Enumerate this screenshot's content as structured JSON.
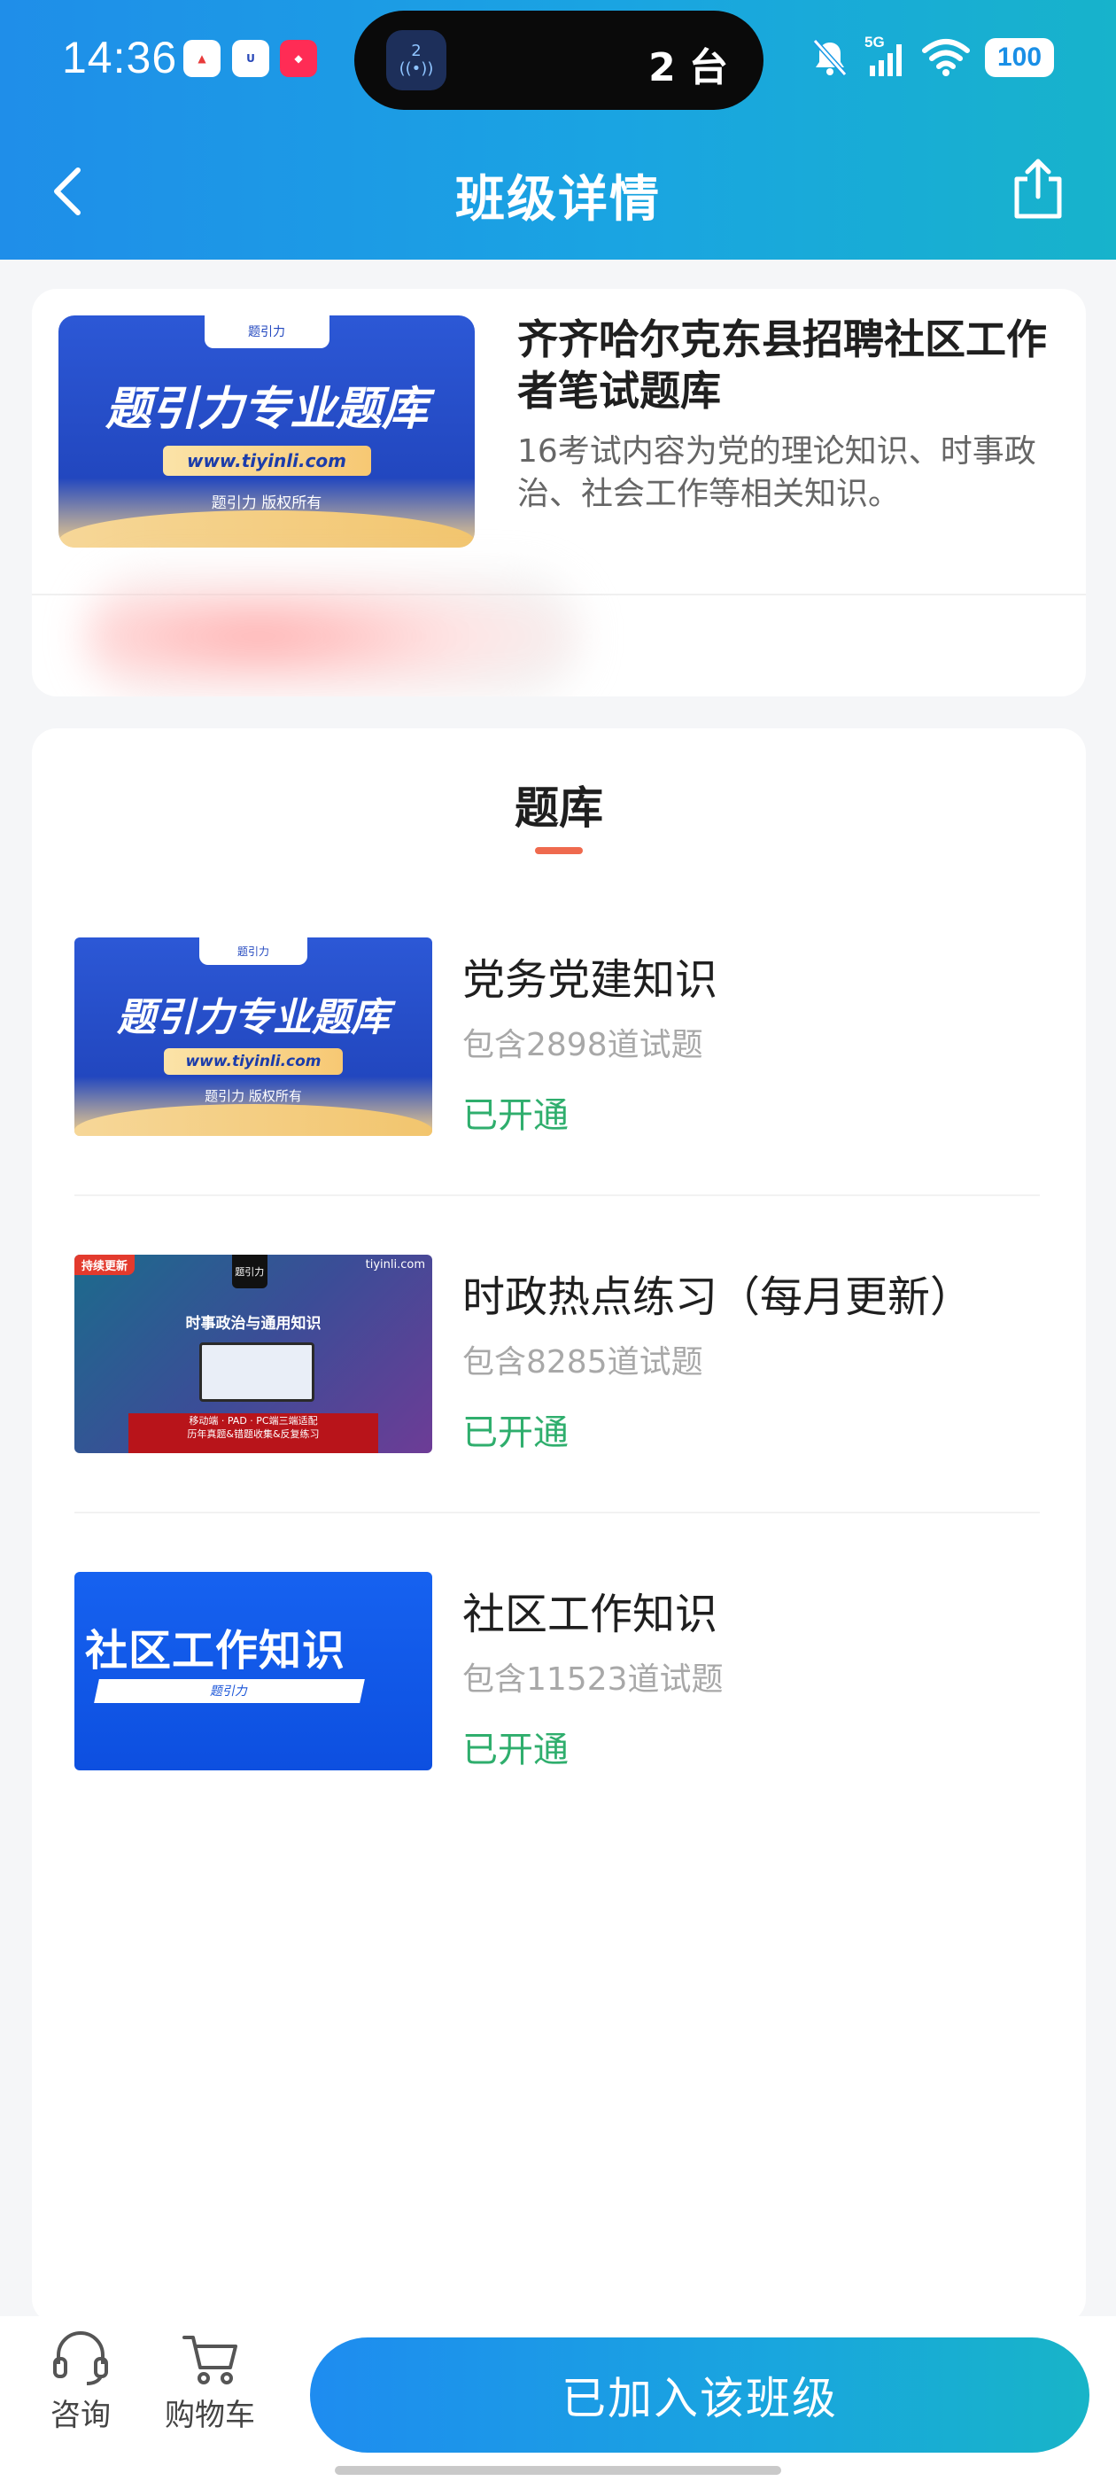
{
  "status_bar": {
    "time": "14:36",
    "island_badge_number": "2",
    "island_text": "2 台",
    "network": "5G",
    "battery": "100"
  },
  "nav": {
    "title": "班级详情"
  },
  "course": {
    "title": "齐齐哈尔克东县招聘社区工作者笔试题库",
    "description": "16考试内容为党的理论知识、时事政治、社会工作等相关知识。"
  },
  "bank": {
    "heading": "题库",
    "items": [
      {
        "title": "党务党建知识",
        "count": "包含2898道试题",
        "status": "已开通",
        "thumb": {
          "tab": "题引力",
          "headline": "题引力专业题库",
          "url": "www.tiyinli.com",
          "copyright": "题引力 版权所有"
        }
      },
      {
        "title": "时政热点练习（每月更新）",
        "count": "包含8285道试题",
        "status": "已开通",
        "thumb": {
          "corner_tag": "持续更新",
          "logo": "题引力",
          "site": "tiyinli.com",
          "subject": "时事政治与通用知识",
          "band_line1": "移动端 · PAD · PC端三端适配",
          "band_line2": "历年真题&错题收集&反复练习"
        }
      },
      {
        "title": "社区工作知识",
        "count": "包含11523道试题",
        "status": "已开通",
        "thumb": {
          "headline": "社区工作知识",
          "pill": "题引力"
        }
      }
    ]
  },
  "course_thumb": {
    "tab": "题引力",
    "headline": "题引力专业题库",
    "url": "www.tiyinli.com",
    "copyright": "题引力 版权所有"
  },
  "bottom_bar": {
    "consult_label": "咨询",
    "cart_label": "购物车",
    "join_label": "已加入该班级"
  },
  "colors": {
    "header_gradient_start": "#1f8ee9",
    "header_gradient_end": "#17b3cb",
    "status_green": "#2fae6d",
    "accent_underline": "#ef6a4e"
  }
}
